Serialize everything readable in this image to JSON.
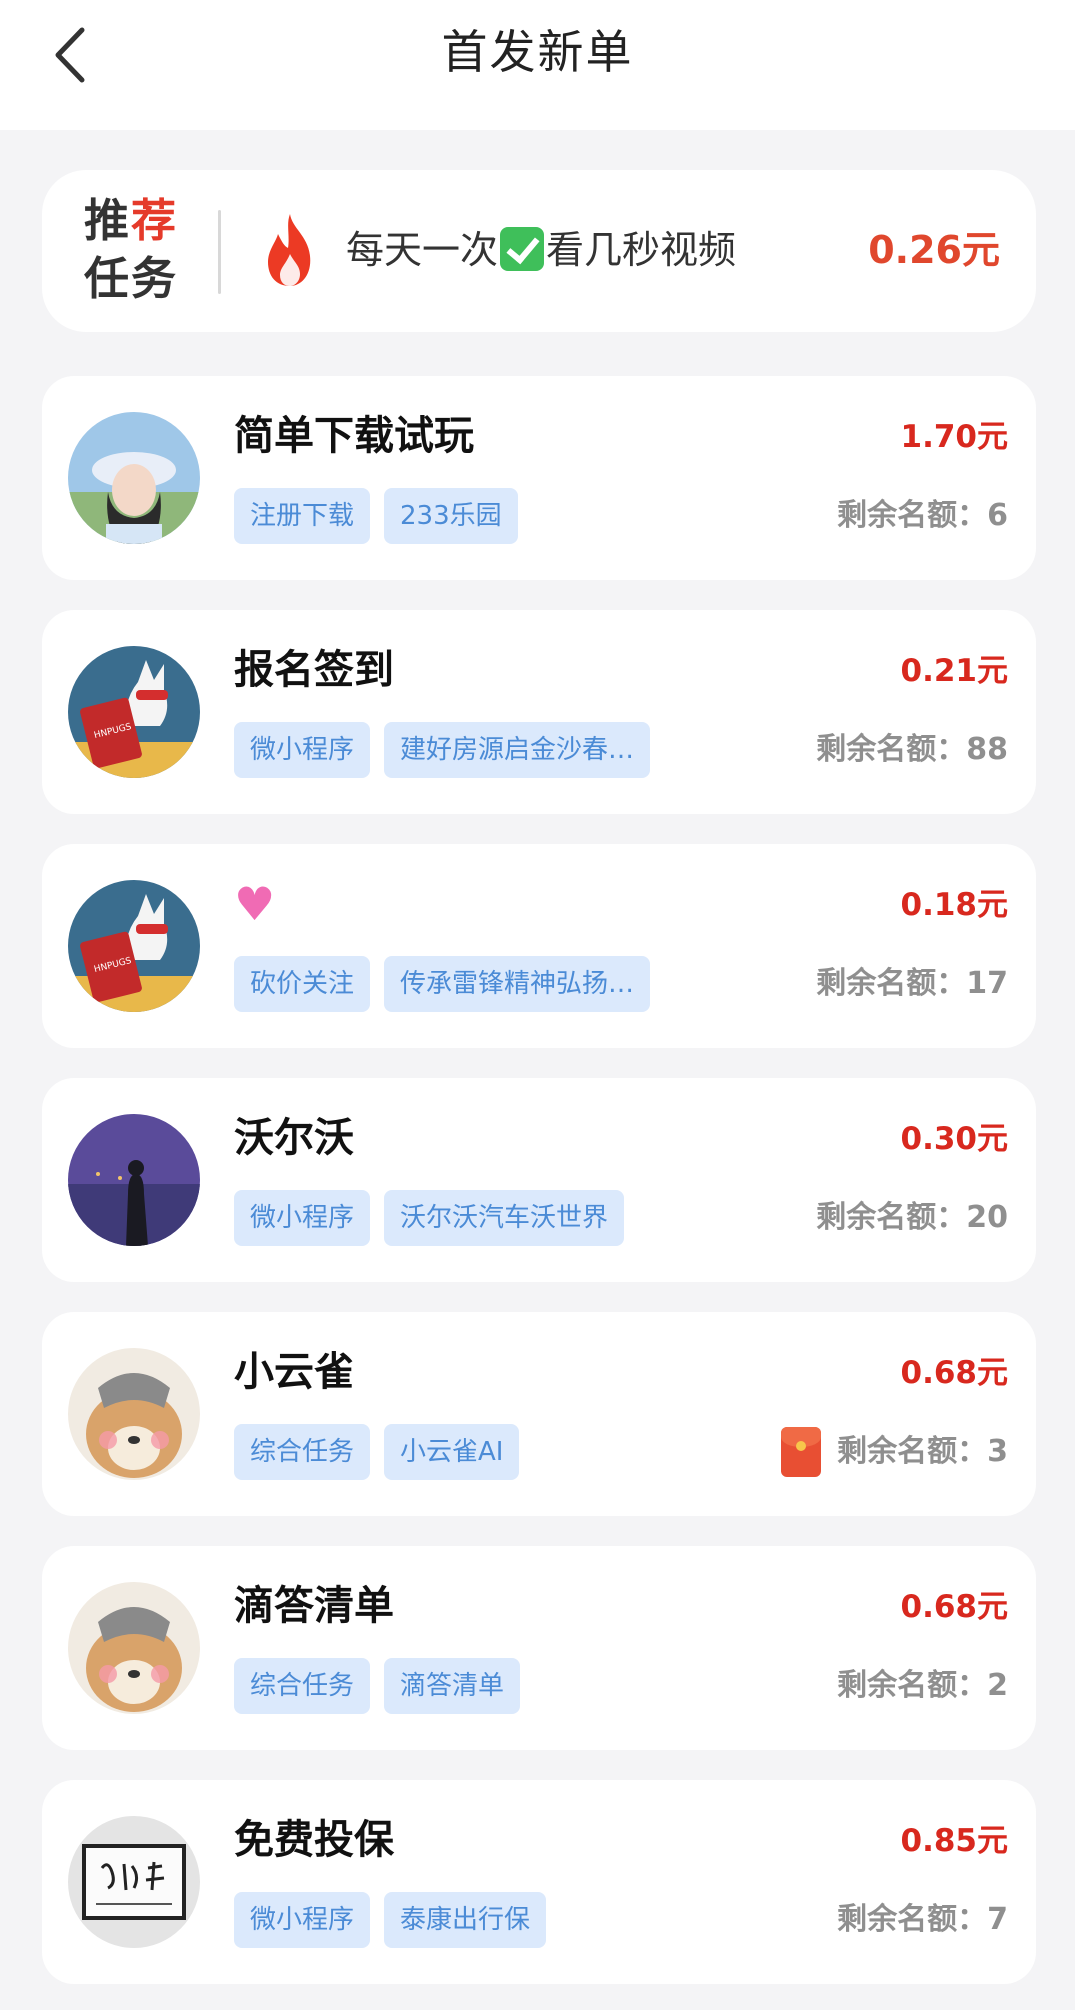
{
  "header": {
    "title": "首发新单",
    "back_icon": "chevron-left-icon"
  },
  "recommend": {
    "label_line1_a": "推",
    "label_line1_b": "荐",
    "label_line2": "任务",
    "text_before": "每天一次",
    "text_after": "看几秒视频",
    "price": "0.26元",
    "icons": [
      "fire-icon",
      "check-icon"
    ]
  },
  "tasks": [
    {
      "title": "简单下载试玩",
      "price": "1.70元",
      "tags": [
        "注册下载",
        "233乐园"
      ],
      "quota": "剩余名额：6",
      "avatar": "woman-hat"
    },
    {
      "title": "报名签到",
      "price": "0.21元",
      "tags": [
        "微小程序",
        "建好房源启金沙春…"
      ],
      "quota": "剩余名额：88",
      "avatar": "cartoon-dog-book"
    },
    {
      "title": "",
      "title_icon": "heart-icon",
      "price": "0.18元",
      "tags": [
        "砍价关注",
        "传承雷锋精神弘扬…"
      ],
      "quota": "剩余名额：17",
      "avatar": "cartoon-dog-book"
    },
    {
      "title": "沃尔沃",
      "price": "0.30元",
      "tags": [
        "微小程序",
        "沃尔沃汽车沃世界"
      ],
      "quota": "剩余名额：20",
      "avatar": "night-silhouette"
    },
    {
      "title": "小云雀",
      "price": "0.68元",
      "tags": [
        "综合任务",
        "小云雀AI"
      ],
      "quota": "剩余名额：3",
      "quota_icon": "red-packet-icon",
      "avatar": "shiba-doodle"
    },
    {
      "title": "滴答清单",
      "price": "0.68元",
      "tags": [
        "综合任务",
        "滴答清单"
      ],
      "quota": "剩余名额：2",
      "avatar": "shiba-doodle"
    },
    {
      "title": "免费投保",
      "price": "0.85元",
      "tags": [
        "微小程序",
        "泰康出行保"
      ],
      "quota": "剩余名额：7",
      "avatar": "calligraphy-frame"
    }
  ],
  "colors": {
    "price_red": "#d8281e",
    "tag_bg": "#dbe9fc",
    "tag_text": "#4b8bd6",
    "page_bg": "#f4f4f6"
  }
}
